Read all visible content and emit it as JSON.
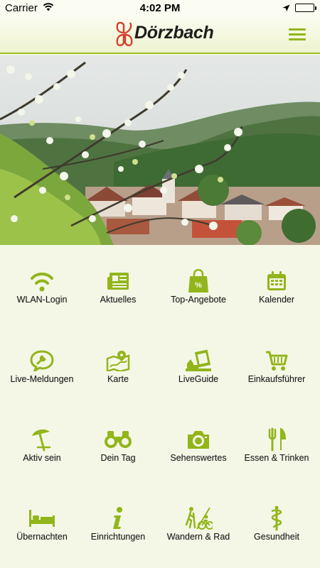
{
  "status_bar": {
    "carrier": "Carrier",
    "time": "4:02 PM"
  },
  "header": {
    "title": "Dörzbach"
  },
  "colors": {
    "accent": "#92b51b",
    "logo_red": "#d6402f",
    "background": "#f4f7e6"
  },
  "tiles": [
    {
      "label": "WLAN-Login",
      "icon": "wifi-icon"
    },
    {
      "label": "Aktuelles",
      "icon": "newspaper-icon"
    },
    {
      "label": "Top-Angebote",
      "icon": "shopping-bag-percent-icon"
    },
    {
      "label": "Kalender",
      "icon": "calendar-icon"
    },
    {
      "label": "Live-Meldungen",
      "icon": "speech-wrench-icon"
    },
    {
      "label": "Karte",
      "icon": "map-pin-icon"
    },
    {
      "label": "LiveGuide",
      "icon": "guide-screen-icon"
    },
    {
      "label": "Einkaufsführer",
      "icon": "shopping-cart-icon"
    },
    {
      "label": "Aktiv sein",
      "icon": "beach-umbrella-icon"
    },
    {
      "label": "Dein Tag",
      "icon": "binoculars-icon"
    },
    {
      "label": "Sehenswertes",
      "icon": "camera-icon"
    },
    {
      "label": "Essen & Trinken",
      "icon": "fork-knife-icon"
    },
    {
      "label": "Übernachten",
      "icon": "bed-icon"
    },
    {
      "label": "Einrichtungen",
      "icon": "info-icon"
    },
    {
      "label": "Wandern & Rad",
      "icon": "hiker-cyclist-icon"
    },
    {
      "label": "Gesundheit",
      "icon": "caduceus-icon"
    }
  ]
}
